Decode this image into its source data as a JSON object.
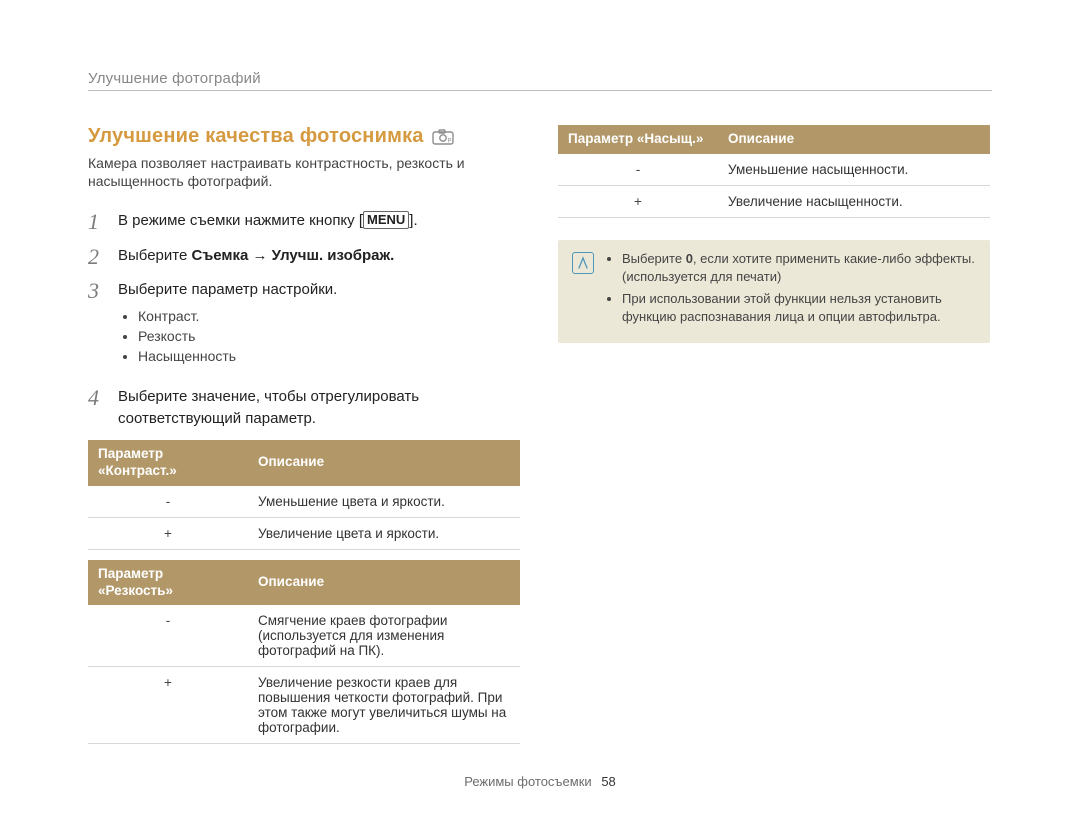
{
  "header": {
    "breadcrumb": "Улучшение фотографий"
  },
  "title": "Улучшение качества фотоснимка",
  "intro": "Камера позволяет настраивать контрастность, резкость и насыщенность фотографий.",
  "steps": {
    "s1_a": "В режиме съемки нажмите кнопку [",
    "s1_menu": "MENU",
    "s1_b": "].",
    "s2_a": "Выберите ",
    "s2_bold": "Съемка → Улучш. изображ.",
    "s3": "Выберите параметр настройки.",
    "s3_items": [
      "Контраст.",
      "Резкость",
      "Насыщенность"
    ],
    "s4": "Выберите значение, чтобы отрегулировать соответствующий параметр."
  },
  "tables": {
    "contrast": {
      "h1": "Параметр «Контраст.»",
      "h2": "Описание",
      "rows": [
        {
          "p": "-",
          "d": "Уменьшение цвета и яркости."
        },
        {
          "p": "+",
          "d": "Увеличение цвета и яркости."
        }
      ]
    },
    "sharpness": {
      "h1": "Параметр «Резкость»",
      "h2": "Описание",
      "rows": [
        {
          "p": "-",
          "d": "Смягчение краев фотографии (используется для изменения фотографий на ПК)."
        },
        {
          "p": "+",
          "d": "Увеличение резкости краев для повышения четкости фотографий. При этом также могут увеличиться шумы на фотографии."
        }
      ]
    },
    "saturation": {
      "h1": "Параметр «Насыщ.»",
      "h2": "Описание",
      "rows": [
        {
          "p": "-",
          "d": "Уменьшение насыщенности."
        },
        {
          "p": "+",
          "d": "Увеличение насыщенности."
        }
      ]
    }
  },
  "notes": {
    "n1_a": "Выберите ",
    "n1_bold": "0",
    "n1_b": ", если хотите применить какие-либо эффекты. (используется для печати)",
    "n2": "При использовании этой функции нельзя установить функцию распознавания лица и опции автофильтра."
  },
  "footer": {
    "label": "Режимы фотосъемки",
    "page": "58"
  }
}
